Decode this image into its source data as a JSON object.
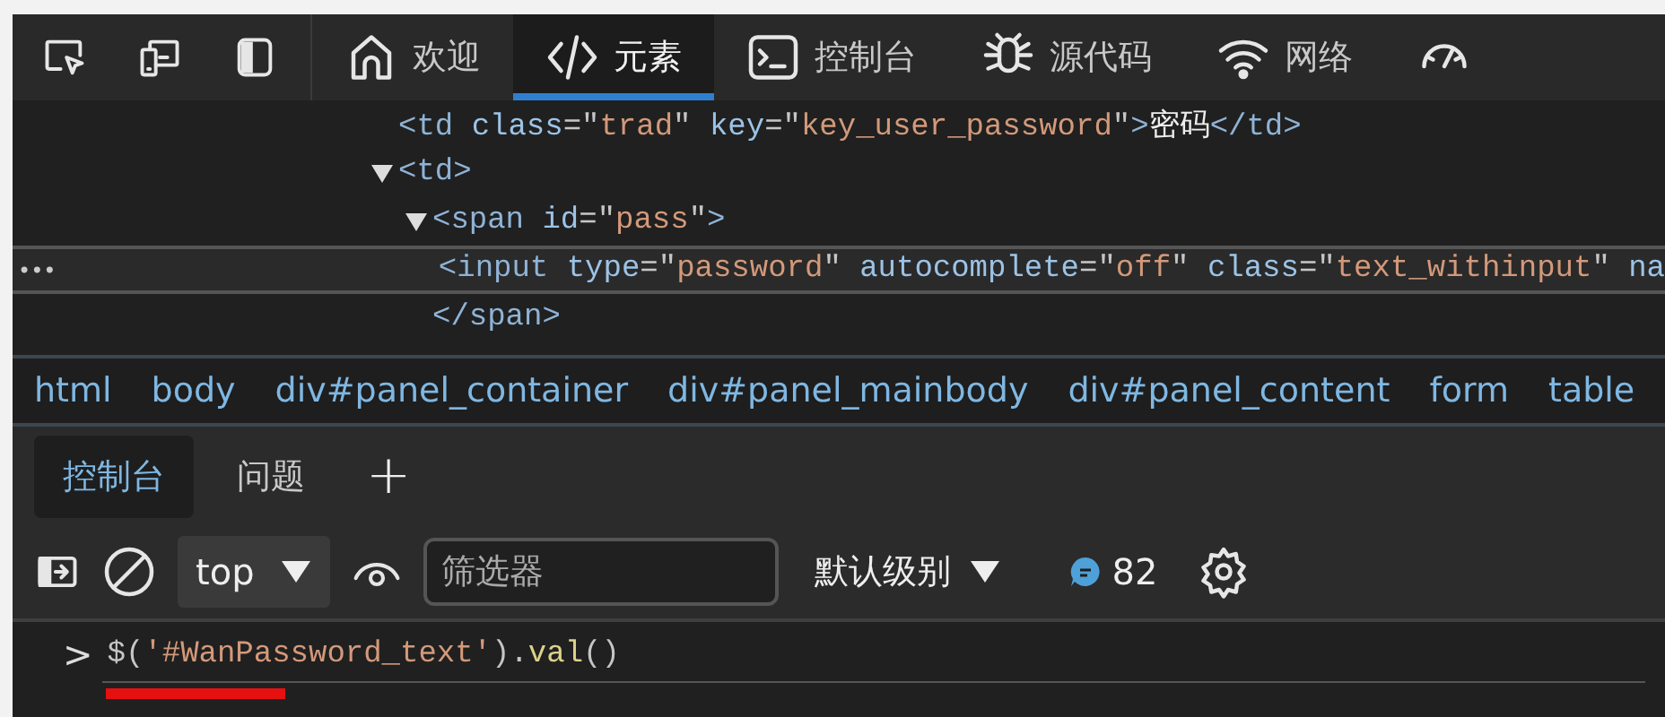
{
  "tabs": [
    {
      "label": "欢迎",
      "selected": false
    },
    {
      "label": "元素",
      "selected": true
    },
    {
      "label": "控制台",
      "selected": false
    },
    {
      "label": "源代码",
      "selected": false
    },
    {
      "label": "网络",
      "selected": false
    },
    {
      "selected": false
    }
  ],
  "dom_tree": {
    "row_menu": "•••",
    "nodes": [
      {
        "selected": false,
        "tokens": [
          {
            "kind": "tag",
            "text": "<td "
          },
          {
            "kind": "attr",
            "text": "class"
          },
          {
            "kind": "punc",
            "text": "=\""
          },
          {
            "kind": "value",
            "text": "trad"
          },
          {
            "kind": "punc",
            "text": "\" "
          },
          {
            "kind": "attr",
            "text": "key"
          },
          {
            "kind": "punc",
            "text": "=\""
          },
          {
            "kind": "value",
            "text": "key_user_password"
          },
          {
            "kind": "punc",
            "text": "\""
          },
          {
            "kind": "tag",
            "text": ">"
          },
          {
            "kind": "text",
            "text": "密码"
          },
          {
            "kind": "tag",
            "text": "</td>"
          }
        ]
      },
      {
        "selected": false,
        "expanded": true,
        "tokens": [
          {
            "kind": "tag",
            "text": "<td>"
          }
        ],
        "children": [
          {
            "selected": false,
            "expanded": true,
            "tokens": [
              {
                "kind": "tag",
                "text": "<span "
              },
              {
                "kind": "attr",
                "text": "id"
              },
              {
                "kind": "punc",
                "text": "=\""
              },
              {
                "kind": "value",
                "text": "pass"
              },
              {
                "kind": "punc",
                "text": "\""
              },
              {
                "kind": "tag",
                "text": ">"
              }
            ],
            "closing": [
              {
                "kind": "tag",
                "text": "</span>"
              }
            ],
            "children": [
              {
                "selected": true,
                "tokens": [
                  {
                    "kind": "tag",
                    "text": "<input "
                  },
                  {
                    "kind": "attr",
                    "text": "type"
                  },
                  {
                    "kind": "punc",
                    "text": "=\""
                  },
                  {
                    "kind": "value",
                    "text": "password"
                  },
                  {
                    "kind": "punc",
                    "text": "\" "
                  },
                  {
                    "kind": "attr",
                    "text": "autocomplete"
                  },
                  {
                    "kind": "punc",
                    "text": "=\""
                  },
                  {
                    "kind": "value",
                    "text": "off"
                  },
                  {
                    "kind": "punc",
                    "text": "\" "
                  },
                  {
                    "kind": "attr",
                    "text": "class"
                  },
                  {
                    "kind": "punc",
                    "text": "=\""
                  },
                  {
                    "kind": "value",
                    "text": "text_withinput"
                  },
                  {
                    "kind": "punc",
                    "text": "\" "
                  },
                  {
                    "kind": "attr",
                    "text": "na"
                  }
                ]
              }
            ]
          }
        ]
      }
    ]
  },
  "breadcrumbs": [
    "html",
    "body",
    "div#panel_container",
    "div#panel_mainbody",
    "div#panel_content",
    "form",
    "table"
  ],
  "drawer_tabs": [
    {
      "label": "控制台",
      "selected": true
    },
    {
      "label": "问题",
      "selected": false
    }
  ],
  "drawer_add": "+",
  "console_toolbar": {
    "context": "top",
    "filter_placeholder": "筛选器",
    "level": "默认级别",
    "message_count": "82"
  },
  "console": {
    "prompt": ">",
    "tokens": [
      {
        "kind": "punc",
        "text": "$("
      },
      {
        "kind": "value",
        "text": "'#WanPassword_text'"
      },
      {
        "kind": "punc",
        "text": ")."
      },
      {
        "kind": "method",
        "text": "val"
      },
      {
        "kind": "punc",
        "text": "()"
      }
    ],
    "redacted": true
  }
}
